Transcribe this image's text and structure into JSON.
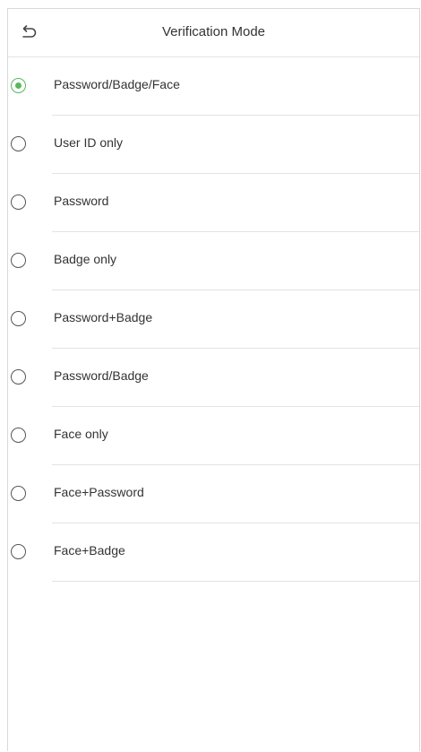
{
  "header": {
    "title": "Verification Mode",
    "back_icon": "back-arrow-icon"
  },
  "accent_color": "#59b85c",
  "selected_index": 0,
  "options": [
    {
      "label": "Password/Badge/Face",
      "selected": true
    },
    {
      "label": "User ID only",
      "selected": false
    },
    {
      "label": "Password",
      "selected": false
    },
    {
      "label": "Badge only",
      "selected": false
    },
    {
      "label": "Password+Badge",
      "selected": false
    },
    {
      "label": "Password/Badge",
      "selected": false
    },
    {
      "label": "Face only",
      "selected": false
    },
    {
      "label": "Face+Password",
      "selected": false
    },
    {
      "label": "Face+Badge",
      "selected": false
    }
  ]
}
